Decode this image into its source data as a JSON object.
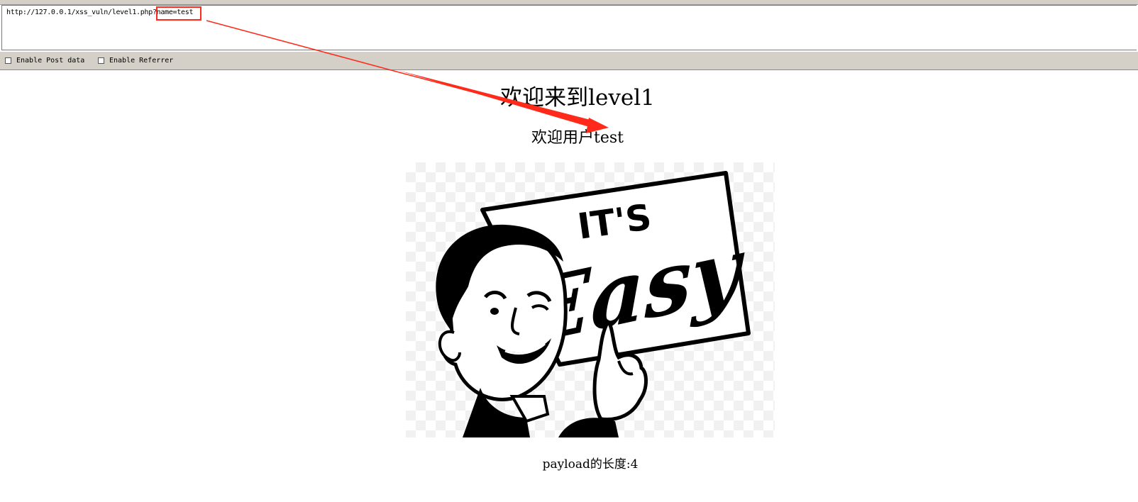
{
  "url_bar": {
    "url_base": "http://127.0.0.1/xss_vuln/level1.php",
    "url_query": "?name=test"
  },
  "options": {
    "post_data_label": "Enable Post data",
    "referrer_label": "Enable Referrer"
  },
  "page": {
    "title": "欢迎来到level1",
    "welcome": "欢迎用户test",
    "image_text_top": "IT'S",
    "image_text_bottom": "Easy",
    "payload_length": "payload的长度:4"
  },
  "colors": {
    "annotation": "#ff2a1a",
    "chrome_gray": "#d4d0c8"
  }
}
